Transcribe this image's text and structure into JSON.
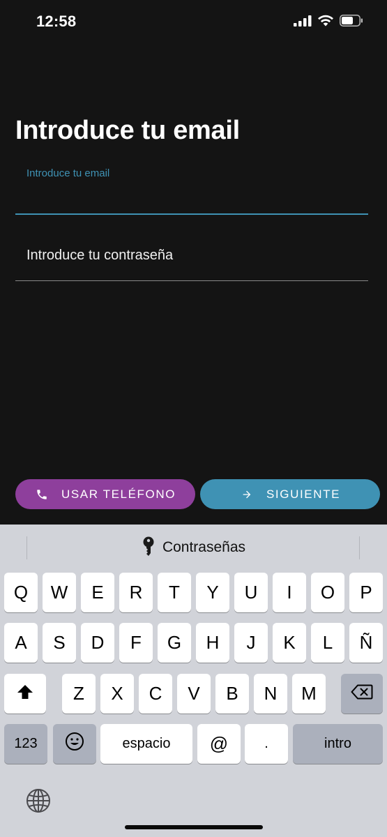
{
  "status_bar": {
    "time": "12:58"
  },
  "form": {
    "title": "Introduce tu email",
    "email_label": "Introduce tu email",
    "email_value": "",
    "password_placeholder": "Introduce tu contraseña",
    "accent_color": "#3f92b4"
  },
  "actions": {
    "phone_button": {
      "label": "USAR TELÉFONO",
      "icon": "phone-icon",
      "color": "#8e3f9c"
    },
    "next_button": {
      "label": "SIGUIENTE",
      "icon": "arrow-right-icon",
      "color": "#3f92b4"
    }
  },
  "keyboard": {
    "suggestion": {
      "label": "Contraseñas",
      "icon": "key-icon"
    },
    "row1": [
      "Q",
      "W",
      "E",
      "R",
      "T",
      "Y",
      "U",
      "I",
      "O",
      "P"
    ],
    "row2": [
      "A",
      "S",
      "D",
      "F",
      "G",
      "H",
      "J",
      "K",
      "L",
      "Ñ"
    ],
    "row3": [
      "Z",
      "X",
      "C",
      "V",
      "B",
      "N",
      "M"
    ],
    "shift_icon": "shift-icon",
    "backspace_icon": "backspace-icon",
    "numbers_label": "123",
    "emoji_icon": "emoji-icon",
    "space_label": "espacio",
    "at_label": "@",
    "dot_label": ".",
    "return_label": "intro",
    "globe_icon": "globe-icon"
  }
}
